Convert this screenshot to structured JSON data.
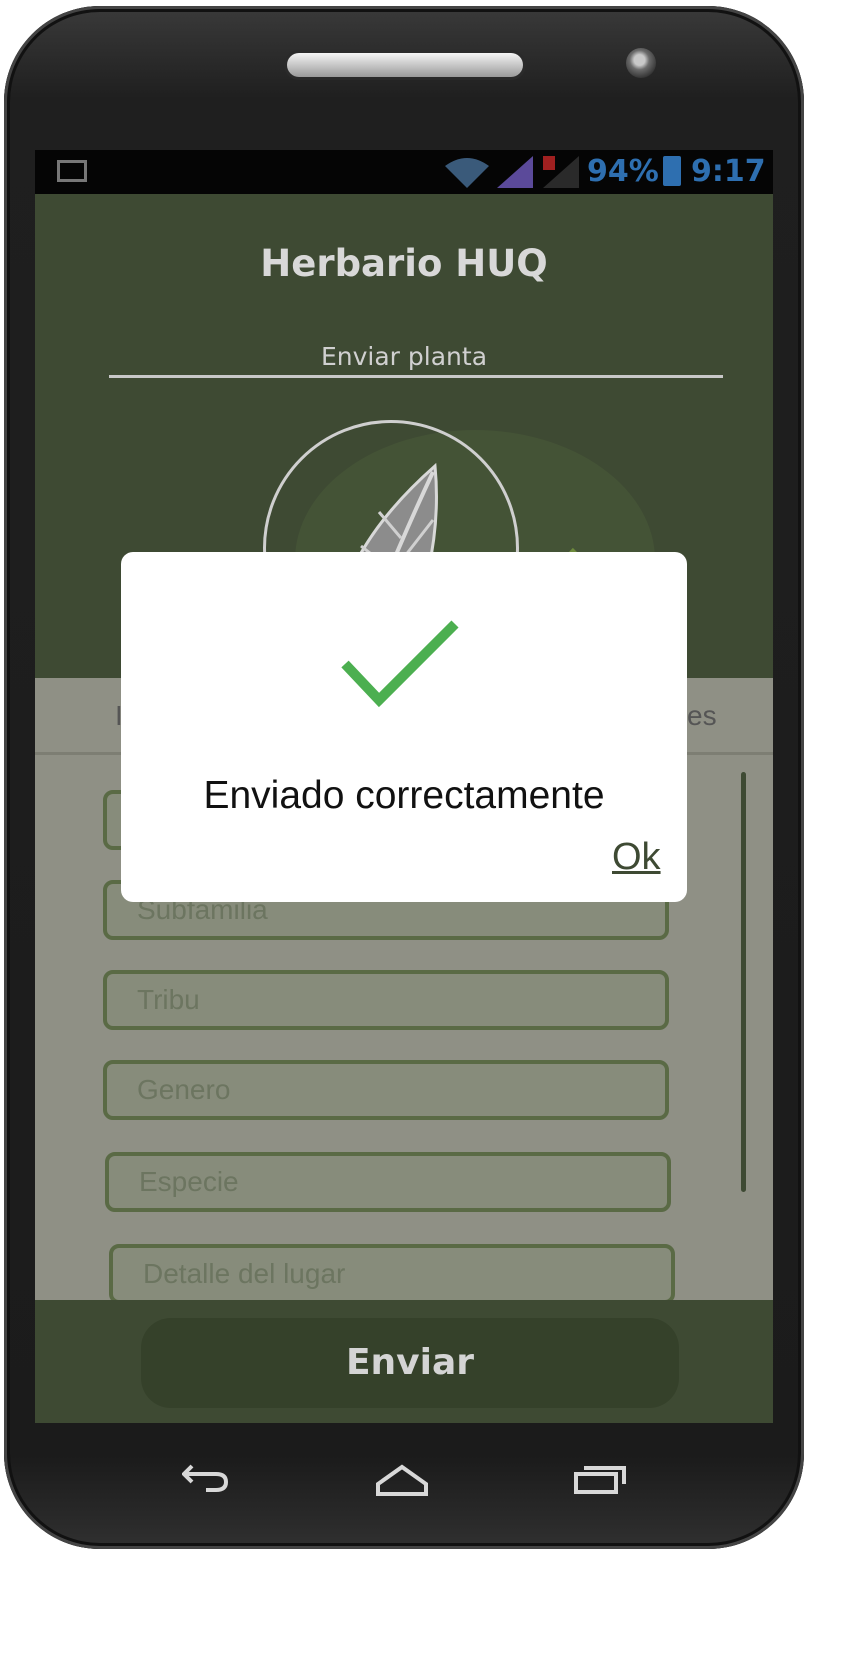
{
  "status_bar": {
    "battery": "94%",
    "time": "9:17",
    "icons": [
      "image-notification-icon",
      "wifi-icon",
      "signal-icon",
      "signal-off-icon",
      "battery-icon"
    ]
  },
  "app": {
    "title": "Herbario HUQ",
    "subtitle": "Enviar planta"
  },
  "tabs": {
    "left_label": "I",
    "right_label": "es"
  },
  "form": {
    "fields": [
      {
        "placeholder": ""
      },
      {
        "placeholder": "Subfamilia"
      },
      {
        "placeholder": "Tribu"
      },
      {
        "placeholder": "Genero"
      },
      {
        "placeholder": "Especie"
      },
      {
        "placeholder": "Detalle del lugar"
      }
    ]
  },
  "submit": {
    "label": "Enviar"
  },
  "dialog": {
    "message": "Enviado correctamente",
    "ok_label": "Ok",
    "icon": "checkmark-icon"
  },
  "colors": {
    "app_green": "#3e4a33",
    "check_green": "#4caf50"
  }
}
